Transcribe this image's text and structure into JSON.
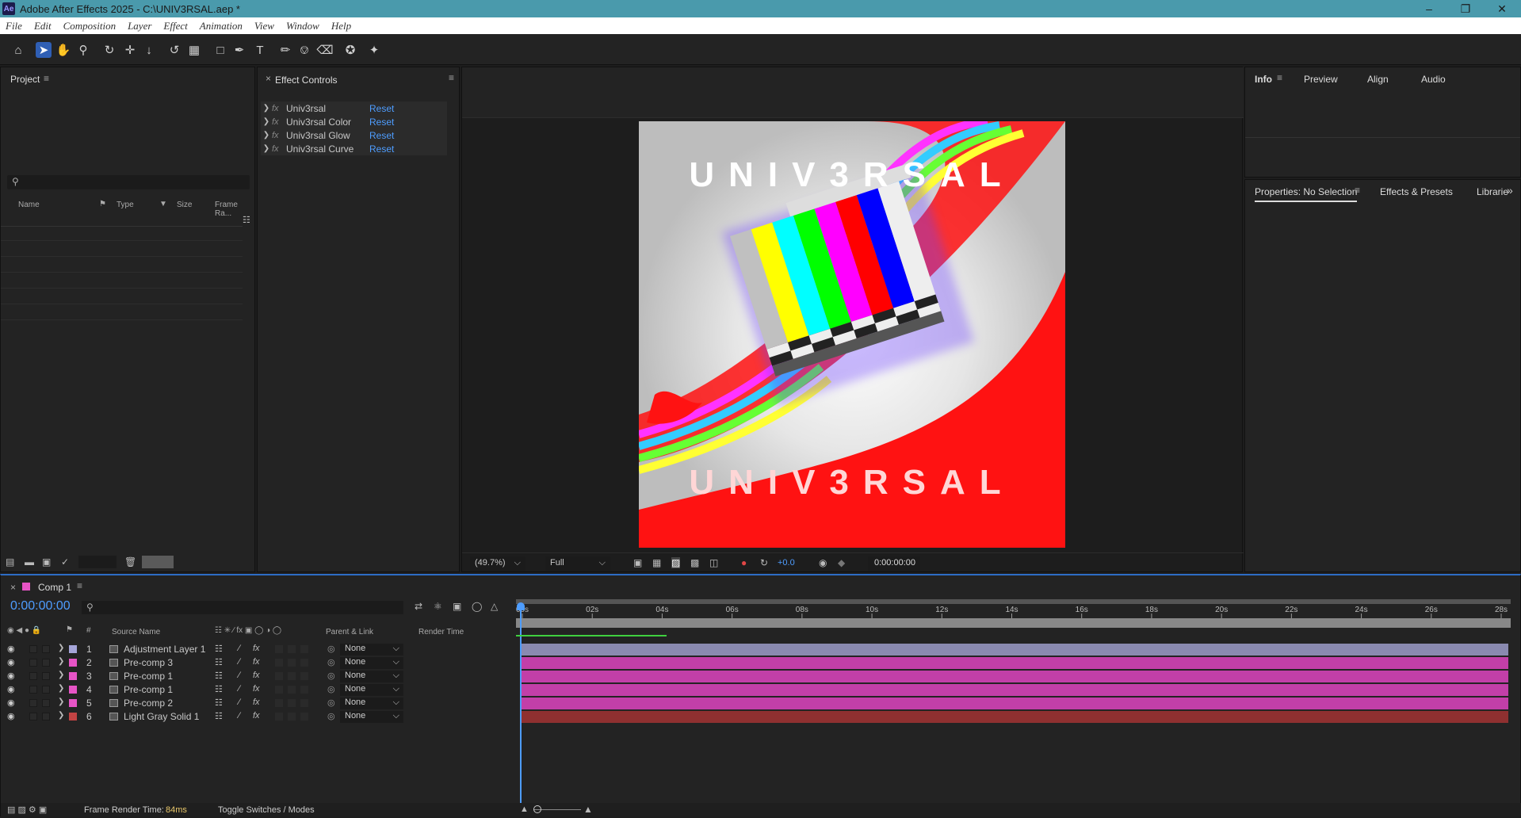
{
  "window": {
    "title": "Adobe After Effects 2025 - C:\\UNIV3RSAL.aep *",
    "logo_text": "Ae"
  },
  "menu": [
    "File",
    "Edit",
    "Composition",
    "Layer",
    "Effect",
    "Animation",
    "View",
    "Window",
    "Help"
  ],
  "project": {
    "title": "Project",
    "search_placeholder": "",
    "columns": [
      "Name",
      "Type",
      "Size",
      "Frame Ra..."
    ]
  },
  "effect_controls": {
    "title": "Effect Controls",
    "effects": [
      {
        "name": "Univ3rsal",
        "reset": "Reset"
      },
      {
        "name": "Univ3rsal Color",
        "reset": "Reset"
      },
      {
        "name": "Univ3rsal Glow",
        "reset": "Reset"
      },
      {
        "name": "Univ3rsal Curve",
        "reset": "Reset"
      }
    ]
  },
  "viewer": {
    "top_text": "UNIV3RSAL",
    "bottom_text": "UNIV3RSAL",
    "zoom": "(49.7%)",
    "resolution": "Full",
    "exposure": "+0.0",
    "timecode": "0:00:00:00"
  },
  "info_tabs": [
    "Info",
    "Preview",
    "Align",
    "Audio"
  ],
  "props_tabs": [
    "Properties: No Selection",
    "Effects & Presets",
    "Librarie"
  ],
  "timeline": {
    "comp_tab": "Comp 1",
    "timecode": "0:00:00:00",
    "columns": {
      "source_name": "Source Name",
      "parent": "Parent & Link",
      "render_time": "Render Time"
    },
    "ruler": [
      "00s",
      "02s",
      "04s",
      "06s",
      "08s",
      "10s",
      "12s",
      "14s",
      "16s",
      "18s",
      "20s",
      "22s",
      "24s",
      "26s",
      "28s"
    ],
    "layers": [
      {
        "num": "1",
        "name": "Adjustment Layer 1",
        "label_color": "#a5a5d8",
        "bar_color": "#8a8ab0",
        "parent": "None"
      },
      {
        "num": "2",
        "name": "Pre-comp 3",
        "label_color": "#e754c6",
        "bar_color": "#c23fa8",
        "parent": "None"
      },
      {
        "num": "3",
        "name": "Pre-comp 1",
        "label_color": "#e754c6",
        "bar_color": "#c23fa8",
        "parent": "None"
      },
      {
        "num": "4",
        "name": "Pre-comp 1",
        "label_color": "#e754c6",
        "bar_color": "#c23fa8",
        "parent": "None"
      },
      {
        "num": "5",
        "name": "Pre-comp 2",
        "label_color": "#e754c6",
        "bar_color": "#c23fa8",
        "parent": "None"
      },
      {
        "num": "6",
        "name": "Light Gray Solid 1",
        "label_color": "#c24343",
        "bar_color": "#8f3030",
        "parent": "None"
      }
    ],
    "footer": {
      "frame_render_label": "Frame Render Time:",
      "frame_render_value": "84ms",
      "toggle": "Toggle Switches / Modes"
    }
  }
}
